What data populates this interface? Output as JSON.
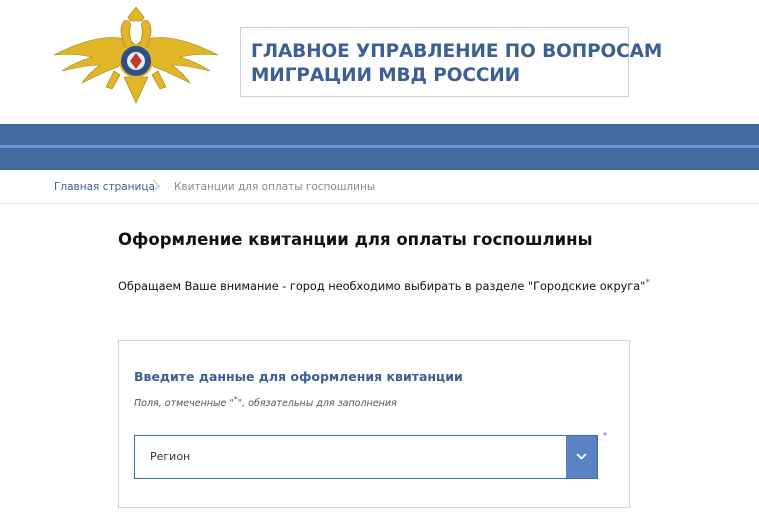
{
  "header": {
    "title_line1": "ГЛАВНОЕ УПРАВЛЕНИЕ ПО ВОПРОСАМ",
    "title_line2": "МИГРАЦИИ МВД РОССИИ",
    "emblem_icon": "double-headed-eagle-emblem"
  },
  "colors": {
    "brand_blue": "#42699e",
    "stripe_blue": "#6d95d6",
    "title_blue": "#3d5f93",
    "select_arrow_bg": "#5b83c4",
    "emblem_gold": "#e0b628"
  },
  "breadcrumb": {
    "home": "Главная страница",
    "separator_icon": "chevron-right-icon",
    "current": "Квитанции для оплаты госпошлины"
  },
  "main": {
    "title": "Оформление квитанции для оплаты госпошлины",
    "notice": "Обращаем Ваше внимание -  город необходимо выбирать в разделе \"Городские округа\"",
    "notice_marker": "*"
  },
  "form": {
    "title": "Введите данные для оформления квитанции",
    "hint_before": "Поля, отмеченные \"",
    "hint_marker": "*",
    "hint_after": "\", обязательны для заполнения",
    "region_select": {
      "value": "Регион",
      "arrow_icon": "chevron-down-icon",
      "required_marker": "*"
    }
  }
}
